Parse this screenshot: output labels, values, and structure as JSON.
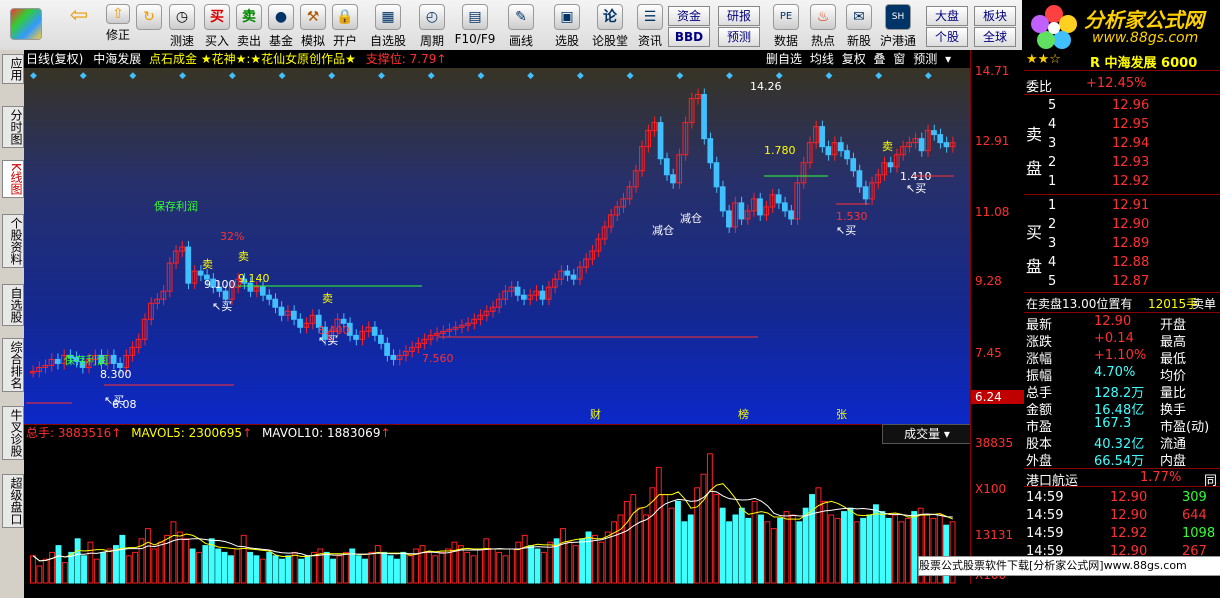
{
  "toolbar": {
    "buttons": [
      "修正",
      "测速",
      "买入",
      "卖出",
      "基金",
      "模拟",
      "开户",
      "自选股",
      "周期",
      "F10/F9",
      "画线",
      "选股",
      "论股堂",
      "资讯",
      "数据",
      "热点",
      "新股",
      "沪港通"
    ],
    "small": {
      "zijin": "资金",
      "bbd": "BBD",
      "yanbao": "研报",
      "yuce": "预测",
      "dapan": "大盘",
      "bankuai": "板块",
      "gegu": "个股",
      "quanqiu": "全球"
    },
    "logo_text": "分析家公式网",
    "logo_url": "www.88gs.com"
  },
  "left_tabs": [
    "应用",
    "分时图",
    "K线图",
    "个股资料",
    "自选股",
    "综合排名",
    "牛叉诊股",
    "超级盘口"
  ],
  "chart_header": {
    "period": "日线(复权)",
    "stock": "中海发展",
    "indicator": "点石成金 ★花神★:★花仙女原创作品★",
    "support_label": "支撑位:",
    "support_value": "7.79",
    "right_items": [
      "删自选",
      "均线",
      "复权",
      "叠",
      "窗",
      "预测"
    ]
  },
  "y_ticks": [
    "14.71",
    "12.91",
    "11.08",
    "9.28",
    "7.45",
    "6.24"
  ],
  "annotations": {
    "save_profit": "保存利润",
    "sell": "卖",
    "buy": "买",
    "reduce": "减仓",
    "cai": "财",
    "bang": "榜",
    "zhang": "张",
    "p1": "9.140",
    "p2": "9.100",
    "p3": "1.780",
    "p4": "1.530",
    "p5": "14.26",
    "p6": "7.560",
    "p7": "6.08",
    "p8": "8.300",
    "p9": "32%",
    "p10": "1.410",
    "p11": "8.400"
  },
  "vol_header": {
    "total": "总手: 3883516",
    "mavol5": "MAVOL5: 2300695",
    "mavol10": "MAVOL10: 1883069",
    "selector": "成交量"
  },
  "vol_ticks": [
    "38835",
    "X100",
    "13131",
    "X100"
  ],
  "chart_data": {
    "type": "bar",
    "ylim": [
      6.24,
      14.71
    ],
    "close": [
      7.2,
      7.3,
      7.35,
      7.5,
      7.4,
      7.6,
      7.55,
      7.45,
      7.3,
      7.5,
      7.6,
      7.4,
      7.6,
      7.4,
      7.3,
      7.6,
      7.8,
      8.0,
      8.5,
      8.9,
      9.0,
      9.2,
      9.9,
      10.2,
      10.3,
      9.4,
      9.7,
      9.6,
      9.5,
      9.3,
      9.2,
      9.0,
      9.3,
      9.5,
      9.4,
      9.2,
      9.3,
      9.1,
      9.0,
      8.8,
      8.6,
      8.7,
      8.5,
      8.3,
      8.4,
      8.6,
      8.3,
      8.0,
      8.2,
      8.5,
      8.4,
      8.1,
      8.0,
      8.2,
      8.3,
      8.1,
      7.9,
      7.6,
      7.5,
      7.6,
      7.7,
      7.8,
      7.9,
      8.0,
      8.1,
      8.15,
      8.2,
      8.25,
      8.3,
      8.35,
      8.4,
      8.5,
      8.6,
      8.7,
      8.8,
      9.0,
      9.2,
      9.3,
      9.1,
      9.0,
      9.1,
      9.2,
      9.0,
      9.3,
      9.5,
      9.7,
      9.6,
      9.5,
      9.8,
      10.0,
      10.2,
      10.5,
      10.8,
      11.1,
      11.3,
      11.5,
      11.8,
      12.2,
      12.8,
      13.2,
      13.4,
      12.5,
      12.1,
      11.9,
      12.6,
      13.4,
      14.0,
      14.1,
      13.0,
      12.4,
      11.8,
      11.2,
      10.8,
      11.4,
      11.0,
      11.2,
      11.5,
      11.1,
      11.3,
      11.6,
      11.4,
      11.2,
      11.0,
      11.9,
      12.4,
      12.9,
      13.3,
      12.8,
      12.6,
      12.9,
      12.7,
      12.5,
      12.2,
      11.8,
      11.5,
      11.9,
      12.1,
      12.4,
      12.3,
      12.6,
      12.8,
      12.9,
      13.0,
      12.7,
      13.2,
      13.1,
      12.9,
      12.8,
      12.9
    ],
    "volume": [
      800,
      500,
      700,
      900,
      1100,
      600,
      900,
      1300,
      800,
      1200,
      700,
      900,
      1000,
      1100,
      1400,
      800,
      900,
      1300,
      1600,
      1000,
      1200,
      1400,
      1800,
      1500,
      1300,
      1000,
      900,
      1100,
      1300,
      1000,
      900,
      800,
      1000,
      1400,
      900,
      800,
      700,
      900,
      800,
      700,
      800,
      900,
      700,
      800,
      900,
      1000,
      900,
      700,
      800,
      900,
      1000,
      800,
      700,
      900,
      1100,
      900,
      800,
      700,
      900,
      800,
      1000,
      1100,
      900,
      800,
      900,
      1000,
      1200,
      1100,
      900,
      800,
      1000,
      1300,
      1000,
      900,
      800,
      1000,
      1200,
      1400,
      1100,
      1000,
      900,
      1200,
      1300,
      1600,
      1200,
      1100,
      1300,
      1500,
      1400,
      1200,
      1500,
      1800,
      2000,
      2400,
      2600,
      2200,
      2000,
      2800,
      3400,
      2600,
      2200,
      2400,
      1800,
      2000,
      2800,
      3200,
      3800,
      2600,
      2200,
      1800,
      2000,
      2200,
      1900,
      2400,
      2000,
      1800,
      1600,
      1900,
      2100,
      2000,
      1800,
      2200,
      2600,
      2800,
      2400,
      2000,
      1900,
      2100,
      2200,
      1800,
      1900,
      2000,
      2300,
      2100,
      1900,
      2000,
      1800,
      1900,
      2100,
      2200,
      2000,
      1900,
      2000,
      1700,
      1800
    ]
  },
  "right_panel": {
    "stock_title": "R 中海发展 6000",
    "weibi_label": "委比",
    "weibi": "+12.45%",
    "sell_label": "卖盘",
    "buy_label": "买盘",
    "sells": [
      [
        "5",
        "12.96"
      ],
      [
        "4",
        "12.95"
      ],
      [
        "3",
        "12.94"
      ],
      [
        "2",
        "12.93"
      ],
      [
        "1",
        "12.92"
      ]
    ],
    "buys": [
      [
        "1",
        "12.91"
      ],
      [
        "2",
        "12.90"
      ],
      [
        "3",
        "12.89"
      ],
      [
        "4",
        "12.88"
      ],
      [
        "5",
        "12.87"
      ]
    ],
    "order_line": "在卖盘13.00位置有",
    "order_qty": "12015手",
    "order_side": "卖单",
    "stats": [
      [
        "最新",
        "12.90",
        "开盘",
        ""
      ],
      [
        "涨跌",
        "+0.14",
        "最高",
        ""
      ],
      [
        "涨幅",
        "+1.10%",
        "最低",
        ""
      ],
      [
        "振幅",
        "4.70%",
        "均价",
        ""
      ],
      [
        "总手",
        "128.2万",
        "量比",
        ""
      ],
      [
        "金额",
        "16.48亿",
        "换手",
        ""
      ],
      [
        "市盈",
        "167.3",
        "市盈(动)",
        ""
      ],
      [
        "股本",
        "40.32亿",
        "流通",
        ""
      ],
      [
        "外盘",
        "66.54万",
        "内盘",
        ""
      ]
    ],
    "ticker_label": "港口航运",
    "ticker_pct": "1.77%",
    "ticker_tag": "同",
    "ticks": [
      [
        "14:59",
        "12.90",
        "309"
      ],
      [
        "14:59",
        "12.90",
        "644"
      ],
      [
        "14:59",
        "12.92",
        "1098"
      ],
      [
        "14:59",
        "12.90",
        "267"
      ],
      [
        "14:59",
        "12.91",
        "583"
      ]
    ]
  },
  "banner": "股票公式股票软件下载[分析家公式网]www.88gs.com"
}
